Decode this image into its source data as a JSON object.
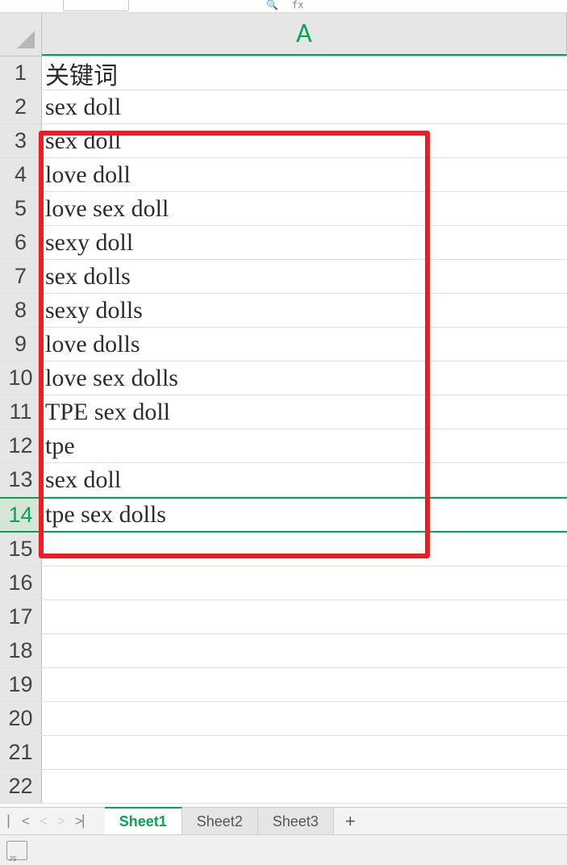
{
  "columns": [
    "A"
  ],
  "rows": [
    {
      "num": 1,
      "a": "关键词"
    },
    {
      "num": 2,
      "a": "sex doll"
    },
    {
      "num": 3,
      "a": "sex doll"
    },
    {
      "num": 4,
      "a": "love doll"
    },
    {
      "num": 5,
      "a": "love sex doll"
    },
    {
      "num": 6,
      "a": "sexy doll"
    },
    {
      "num": 7,
      "a": "sex dolls"
    },
    {
      "num": 8,
      "a": "sexy dolls"
    },
    {
      "num": 9,
      "a": "love dolls"
    },
    {
      "num": 10,
      "a": "love sex dolls"
    },
    {
      "num": 11,
      "a": "TPE sex doll"
    },
    {
      "num": 12,
      "a": "tpe"
    },
    {
      "num": 13,
      "a": "sex doll"
    },
    {
      "num": 14,
      "a": "tpe sex dolls"
    },
    {
      "num": 15,
      "a": ""
    },
    {
      "num": 16,
      "a": ""
    },
    {
      "num": 17,
      "a": ""
    },
    {
      "num": 18,
      "a": ""
    },
    {
      "num": 19,
      "a": ""
    },
    {
      "num": 20,
      "a": ""
    },
    {
      "num": 21,
      "a": ""
    },
    {
      "num": 22,
      "a": ""
    }
  ],
  "selected_row": 14,
  "tabs": {
    "list": [
      "Sheet1",
      "Sheet2",
      "Sheet3"
    ],
    "active": 0,
    "add_label": "+"
  },
  "annotation": {
    "top_row": 3,
    "bottom_row": 15
  },
  "toolbar": {
    "search_glyph": "🔍",
    "fx_glyph": "fx"
  }
}
